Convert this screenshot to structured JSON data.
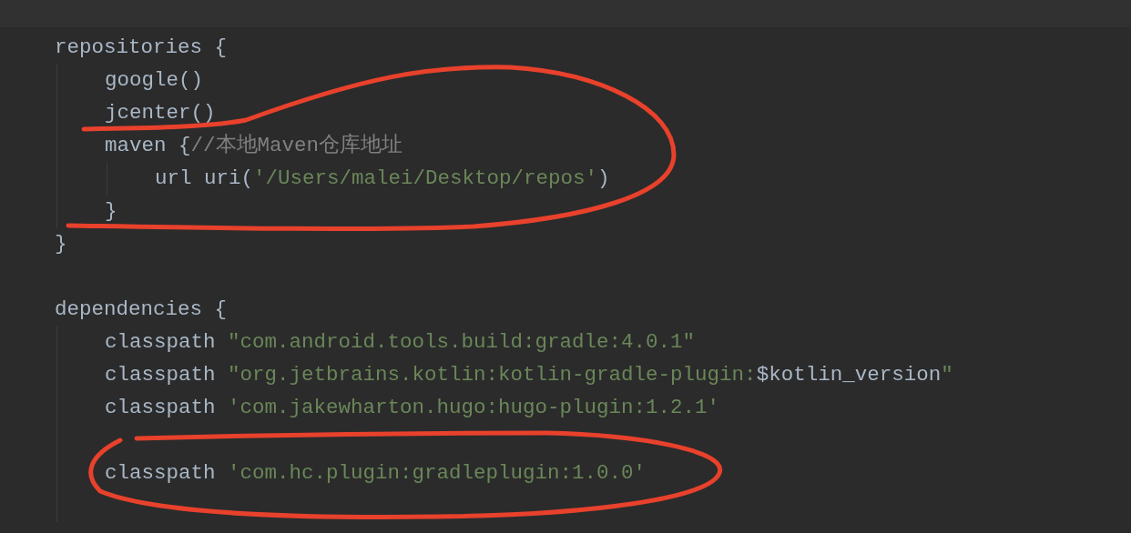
{
  "editor": {
    "lines": [
      {
        "kind": "code",
        "tokens": [
          {
            "kind": "plain",
            "text": "repositories {"
          }
        ],
        "children": [
          {
            "kind": "code",
            "tokens": [
              {
                "kind": "plain",
                "text": "google()"
              }
            ]
          },
          {
            "kind": "code",
            "tokens": [
              {
                "kind": "plain",
                "text": "jcenter()"
              }
            ]
          },
          {
            "kind": "code",
            "tokens": [
              {
                "kind": "plain",
                "text": "maven {"
              },
              {
                "kind": "comment",
                "text": "//本地Maven仓库地址"
              }
            ],
            "children": [
              {
                "kind": "code",
                "tokens": [
                  {
                    "kind": "plain",
                    "text": "url uri("
                  },
                  {
                    "kind": "string",
                    "text": "'/Users/malei/Desktop/repos'"
                  },
                  {
                    "kind": "plain",
                    "text": ")"
                  }
                ]
              }
            ]
          },
          {
            "kind": "code",
            "tokens": [
              {
                "kind": "plain",
                "text": "}"
              }
            ]
          }
        ]
      },
      {
        "kind": "code",
        "tokens": [
          {
            "kind": "plain",
            "text": "}"
          }
        ]
      },
      {
        "kind": "blank"
      },
      {
        "kind": "code",
        "tokens": [
          {
            "kind": "plain",
            "text": "dependencies {"
          }
        ],
        "children": [
          {
            "kind": "code",
            "tokens": [
              {
                "kind": "plain",
                "text": "classpath "
              },
              {
                "kind": "string",
                "text": "\"com.android.tools.build:gradle:4.0.1\""
              }
            ]
          },
          {
            "kind": "code",
            "tokens": [
              {
                "kind": "plain",
                "text": "classpath "
              },
              {
                "kind": "string",
                "text": "\"org.jetbrains.kotlin:kotlin-gradle-plugin:"
              },
              {
                "kind": "plain",
                "text": "$kotlin_version"
              },
              {
                "kind": "string",
                "text": "\""
              }
            ]
          },
          {
            "kind": "code",
            "tokens": [
              {
                "kind": "plain",
                "text": "classpath "
              },
              {
                "kind": "string",
                "text": "'com.jakewharton.hugo:hugo-plugin:1.2.1'"
              }
            ]
          },
          {
            "kind": "blank"
          },
          {
            "kind": "code",
            "tokens": [
              {
                "kind": "plain",
                "text": "classpath "
              },
              {
                "kind": "string",
                "text": "'com.hc.plugin:gradleplugin:1.0.0'"
              }
            ]
          },
          {
            "kind": "blank"
          }
        ]
      }
    ]
  },
  "annotations": [
    {
      "kind": "loop"
    },
    {
      "kind": "loop"
    }
  ]
}
